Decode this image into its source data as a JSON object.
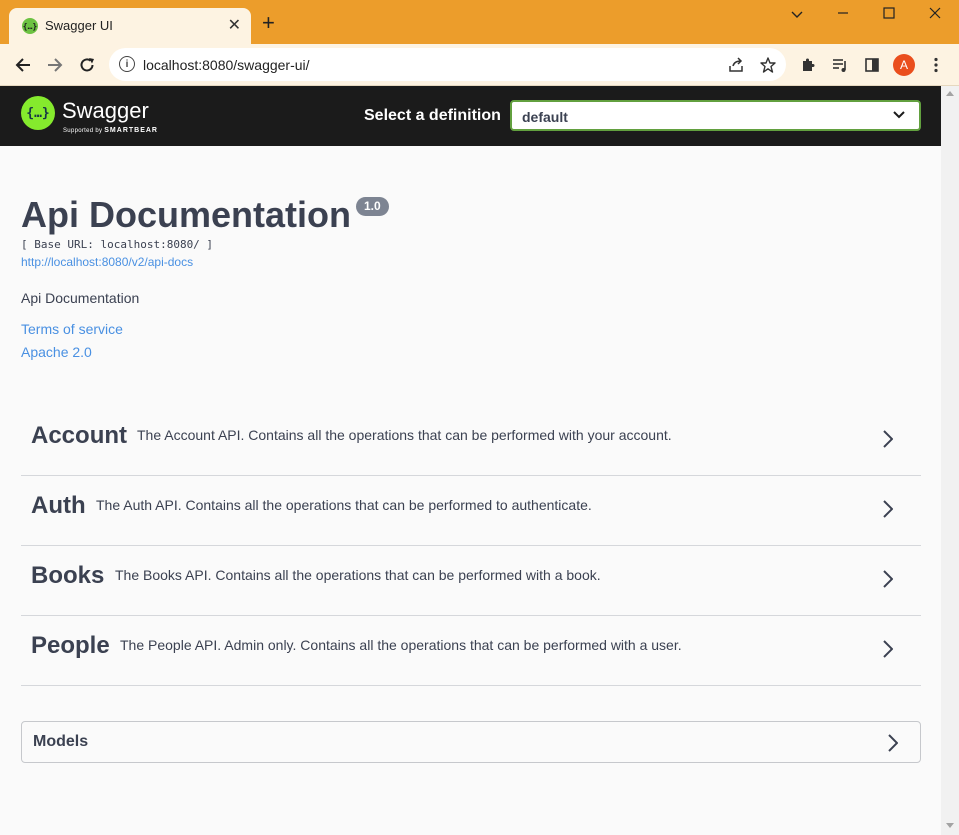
{
  "browser": {
    "tab_title": "Swagger UI",
    "tab_favicon_glyph": "{…}",
    "url": "localhost:8080/swagger-ui/",
    "avatar_letter": "A",
    "frame_color": "#ec9d2b",
    "toolbar_color": "#fdf3e2"
  },
  "swagger_header": {
    "logo_glyph": "{…}",
    "brand": "Swagger",
    "supported_by": "Supported by",
    "smartbear": "SMARTBEAR",
    "definition_label": "Select a definition",
    "definition_value": "default",
    "bg_color": "#1b1b1b",
    "accent_color": "#85ea2d"
  },
  "info": {
    "title": "Api Documentation",
    "version": "1.0",
    "base_url": "[ Base URL: localhost:8080/ ]",
    "docs_link": "http://localhost:8080/v2/api-docs",
    "description": "Api Documentation",
    "terms_link": "Terms of service",
    "license_link": "Apache 2.0",
    "link_color": "#4990e2"
  },
  "tags": [
    {
      "name": "Account",
      "description": "The Account API. Contains all the operations that can be performed with your account."
    },
    {
      "name": "Auth",
      "description": "The Auth API. Contains all the operations that can be performed to authenticate."
    },
    {
      "name": "Books",
      "description": "The Books API. Contains all the operations that can be performed with a book."
    },
    {
      "name": "People",
      "description": "The People API. Admin only. Contains all the operations that can be performed with a user."
    }
  ],
  "models": {
    "title": "Models"
  },
  "icons": {
    "back": "arrow-left-icon",
    "forward": "arrow-right-icon",
    "reload": "reload-icon",
    "info": "info-icon",
    "share": "share-icon",
    "bookmark": "star-icon",
    "extensions": "puzzle-icon",
    "media": "media-queue-icon",
    "sidepanel": "side-panel-icon",
    "menu": "kebab-menu-icon",
    "expand": "chevron-right-icon"
  }
}
